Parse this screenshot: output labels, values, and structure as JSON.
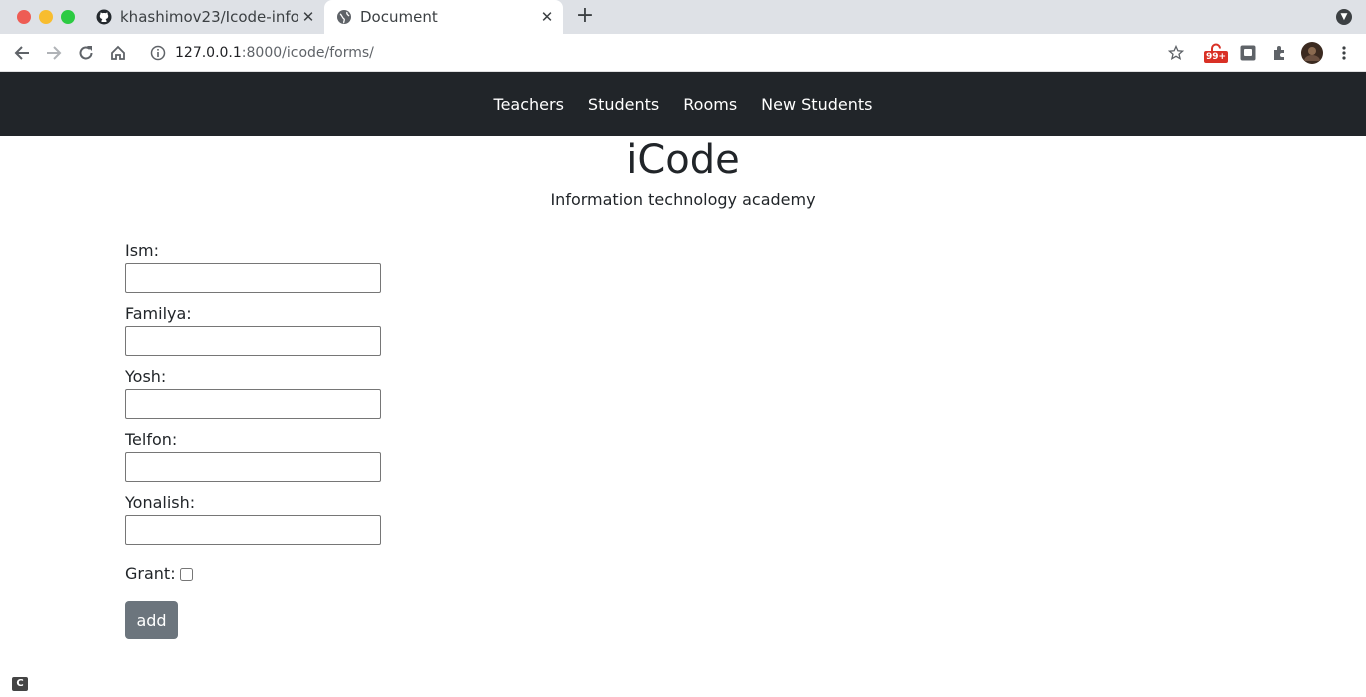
{
  "tabs": [
    {
      "title": "khashimov23/Icode-info",
      "icon": "github-icon"
    },
    {
      "title": "Document",
      "icon": "globe-icon"
    }
  ],
  "address": {
    "host": "127.0.0.1",
    "path": ":8000/icode/forms/"
  },
  "extensions": {
    "badge": "99+"
  },
  "nav": {
    "links": [
      "Teachers",
      "Students",
      "Rooms",
      "New Students"
    ]
  },
  "header": {
    "title": "iCode",
    "subtitle": "Information technology academy"
  },
  "form": {
    "fields": [
      {
        "label": "Ism:",
        "value": ""
      },
      {
        "label": "Familya:",
        "value": ""
      },
      {
        "label": "Yosh:",
        "value": ""
      },
      {
        "label": "Telfon:",
        "value": ""
      },
      {
        "label": "Yonalish:",
        "value": ""
      }
    ],
    "grant_label": "Grant:",
    "grant_checked": false,
    "submit_label": "add"
  },
  "corner_glyph": "C",
  "colors": {
    "navbar": "#212529",
    "button": "#6c757d",
    "badge": "#d93025"
  }
}
